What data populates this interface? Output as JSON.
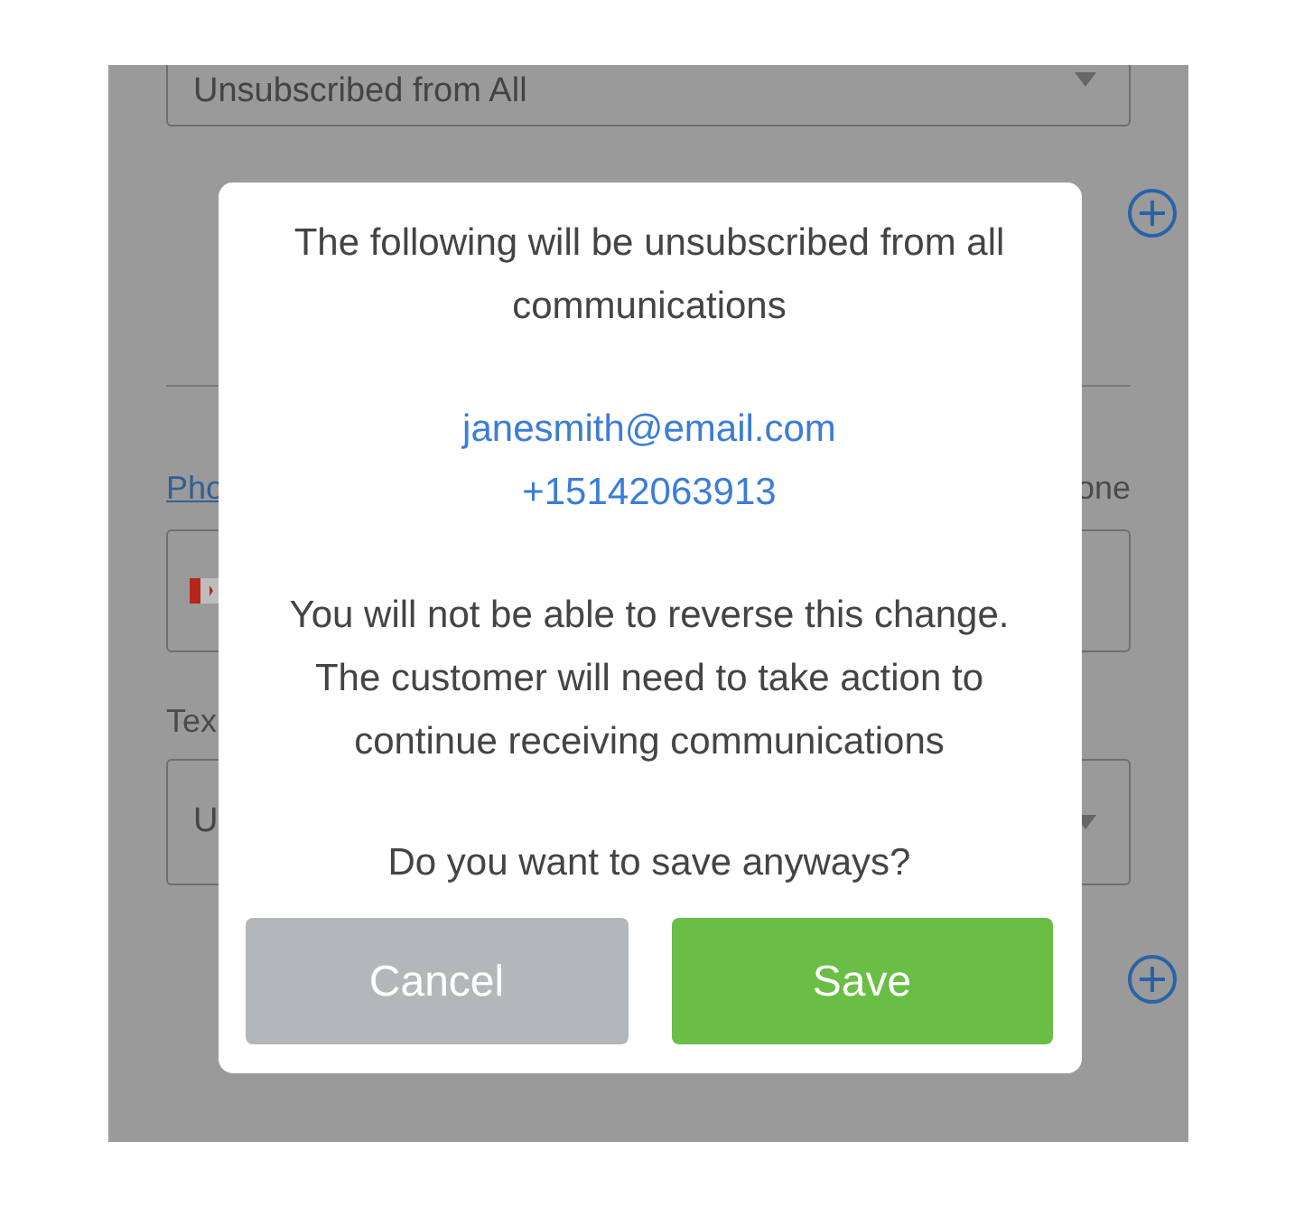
{
  "form": {
    "email_status_select": {
      "value": "Unsubscribed from All"
    },
    "phone_label": "Pho",
    "phone_label_right": "one",
    "text_label": "Tex",
    "text_status_select": {
      "value": "U"
    }
  },
  "dialog": {
    "message": "The following will be unsubscribed from all communications",
    "contacts": [
      "janesmith@email.com",
      "+15142063913"
    ],
    "warning": "You will not be able to reverse this change. The customer will need to take action to continue receiving communications",
    "question": "Do you want to save anyways?",
    "buttons": [
      {
        "label": "Cancel",
        "kind": "secondary"
      },
      {
        "label": "Save",
        "kind": "primary"
      }
    ]
  }
}
